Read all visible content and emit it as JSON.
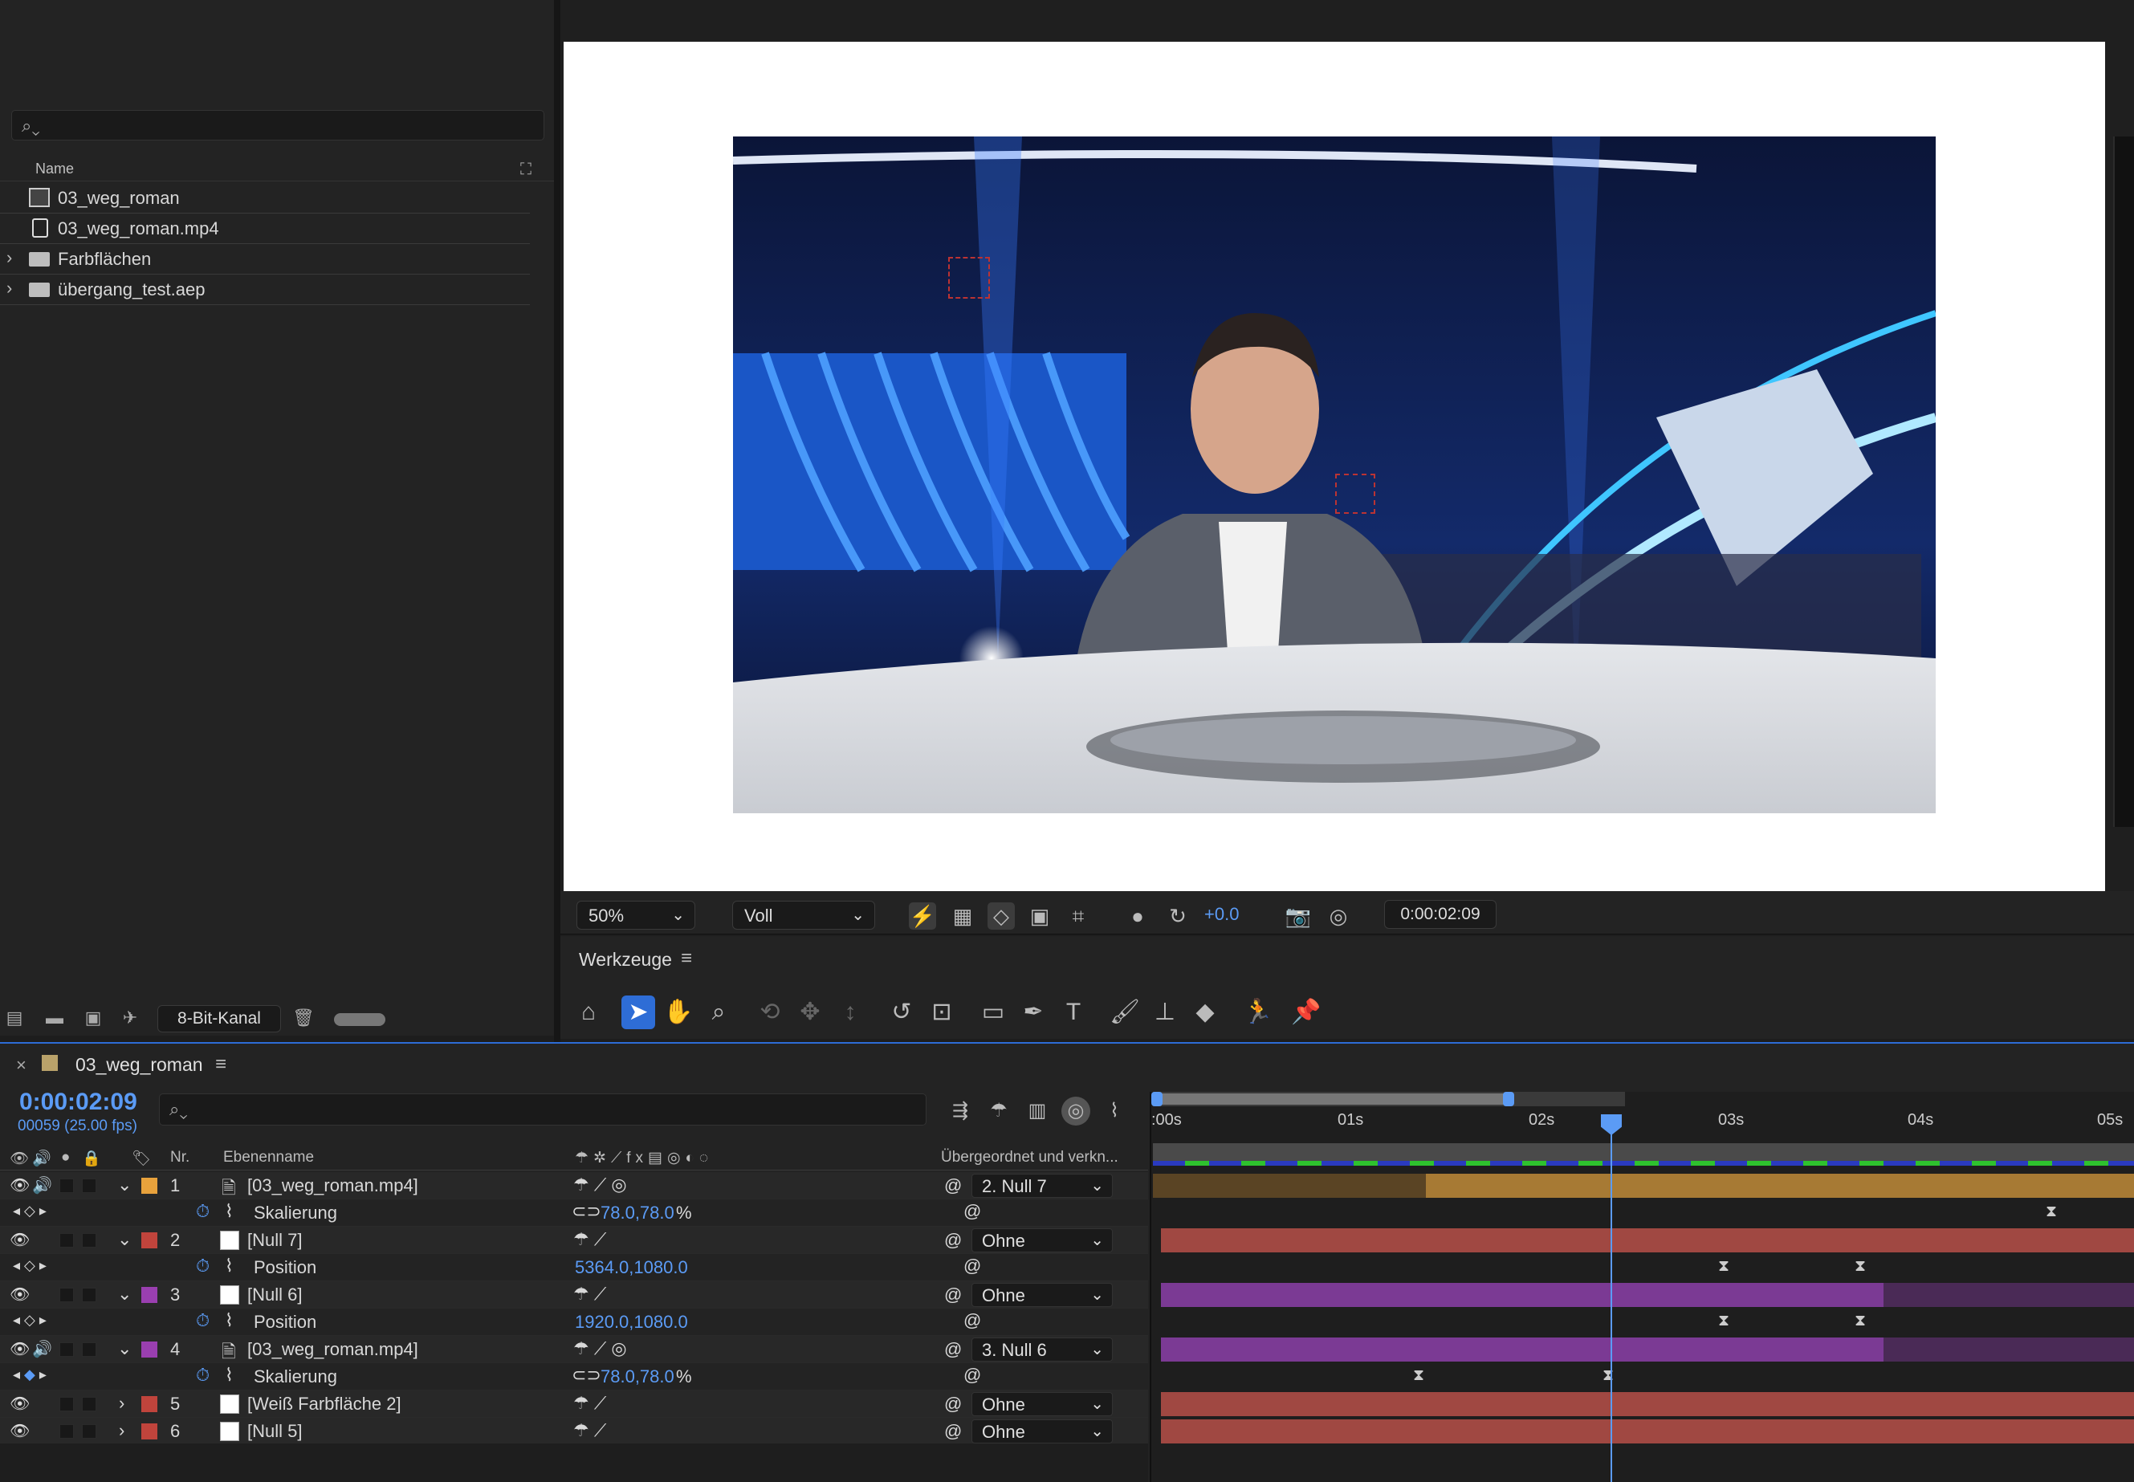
{
  "project": {
    "search_placeholder": "",
    "column_name": "Name",
    "items": [
      {
        "name": "03_weg_roman",
        "type": "comp"
      },
      {
        "name": "03_weg_roman.mp4",
        "type": "footage"
      },
      {
        "name": "Farbflächen",
        "type": "folder"
      },
      {
        "name": "übergang_test.aep",
        "type": "folder"
      }
    ],
    "bit_depth": "8-Bit-Kanal"
  },
  "viewer": {
    "zoom": "50%",
    "resolution": "Voll",
    "exposure": "+0.0",
    "timecode": "0:00:02:09"
  },
  "tools": {
    "title": "Werkzeuge",
    "active_tool": "selection-tool"
  },
  "timeline": {
    "comp_tab": "03_weg_roman",
    "timecode": "0:00:02:09",
    "frame_info": "00059 (25.00 fps)",
    "columns": {
      "nr": "Nr.",
      "layer_name": "Ebenenname",
      "parent": "Übergeordnet und verkn..."
    },
    "ruler": [
      ":00s",
      "01s",
      "02s",
      "03s",
      "04s",
      "05s"
    ],
    "layers": [
      {
        "nr": "1",
        "name": "[03_weg_roman.mp4]",
        "parent": "2. Null 7",
        "label_color": "#e8a23c",
        "prop": "Skalierung",
        "prop_value": "78.0,78.0",
        "unit": "%"
      },
      {
        "nr": "2",
        "name": "[Null 7]",
        "parent": "Ohne",
        "label_color": "#c0443c",
        "prop": "Position",
        "prop_value": "5364.0,1080.0",
        "unit": ""
      },
      {
        "nr": "3",
        "name": "[Null 6]",
        "parent": "Ohne",
        "label_color": "#9a3fb0",
        "prop": "Position",
        "prop_value": "1920.0,1080.0",
        "unit": ""
      },
      {
        "nr": "4",
        "name": "[03_weg_roman.mp4]",
        "parent": "3. Null 6",
        "label_color": "#9a3fb0",
        "prop": "Skalierung",
        "prop_value": "78.0,78.0",
        "unit": "%"
      },
      {
        "nr": "5",
        "name": "[Weiß Farbfläche 2]",
        "parent": "Ohne",
        "label_color": "#c0443c"
      },
      {
        "nr": "6",
        "name": "[Null 5]",
        "parent": "Ohne",
        "label_color": "#c0443c"
      }
    ]
  }
}
